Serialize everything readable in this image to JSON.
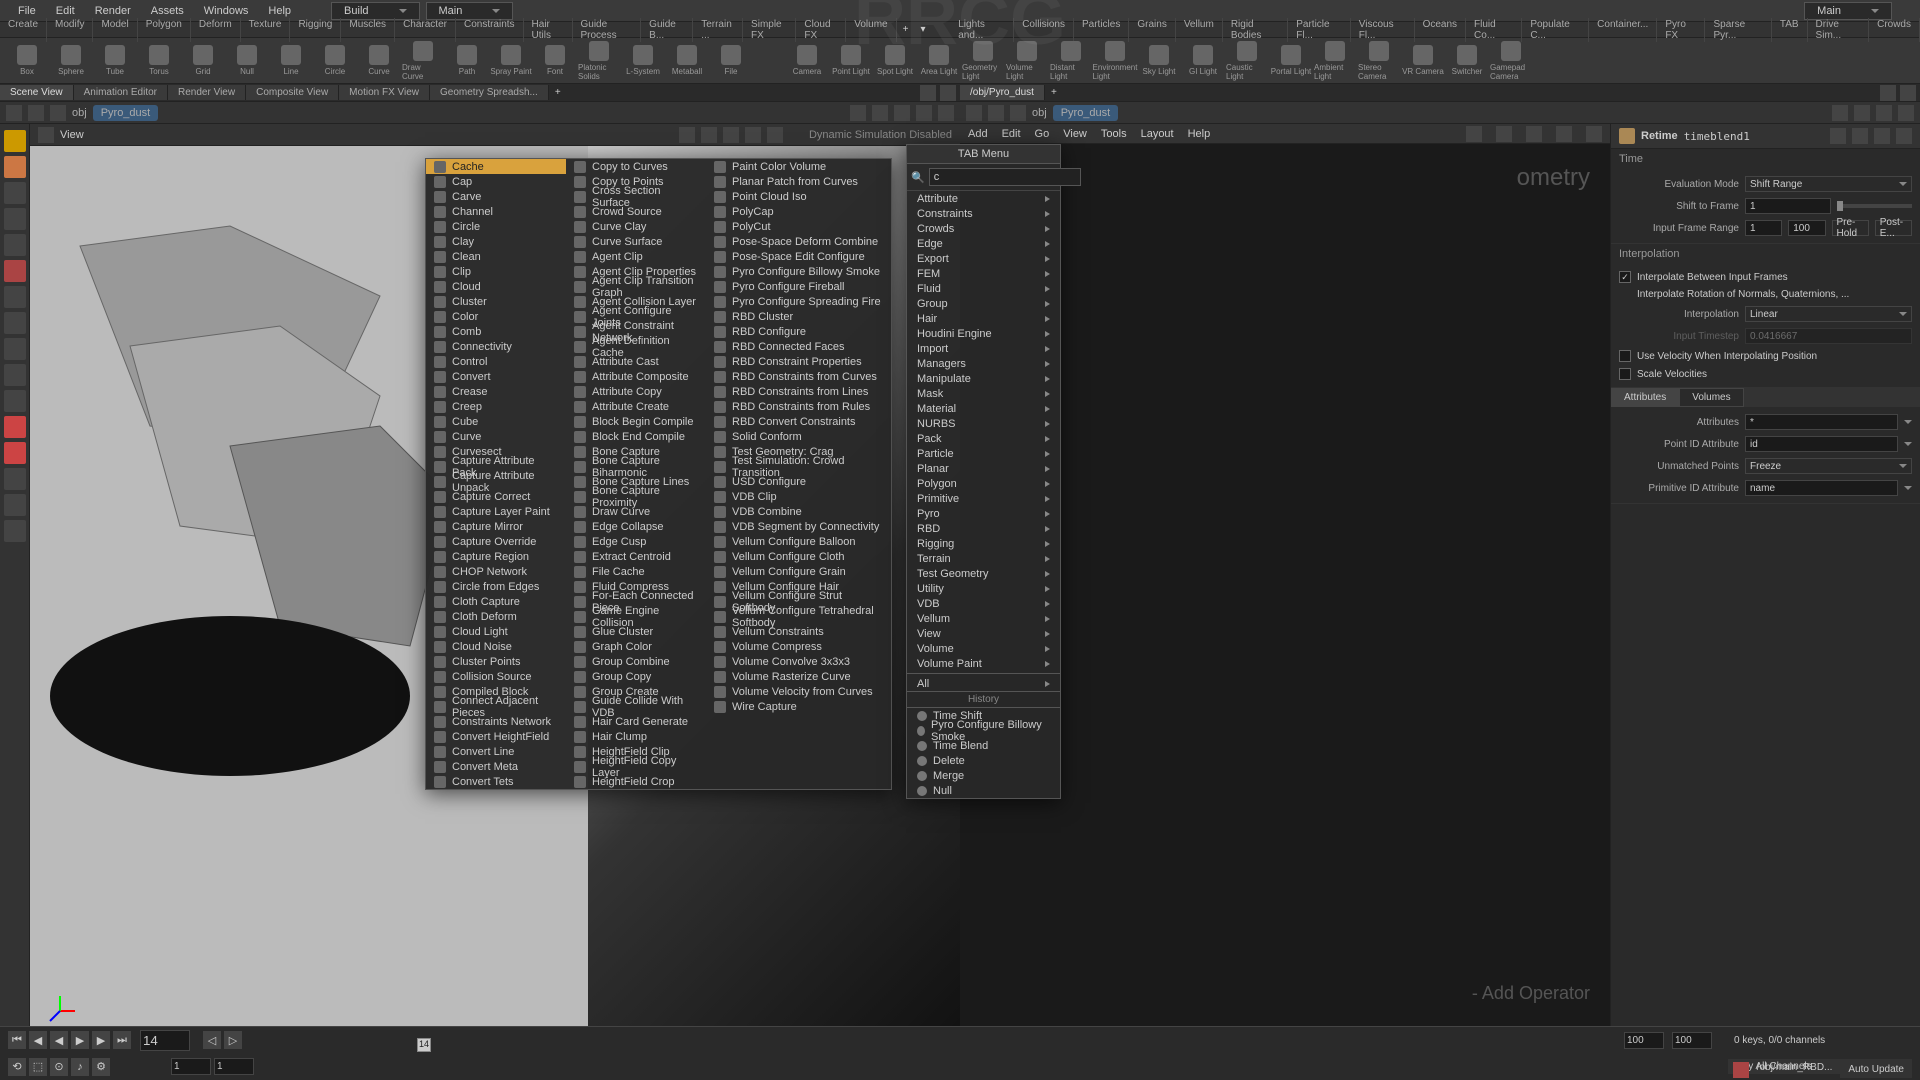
{
  "watermark": "RRCG",
  "menubar": {
    "items": [
      "File",
      "Edit",
      "Render",
      "Assets",
      "Windows",
      "Help"
    ],
    "desktop1": "Build",
    "desktop2": "Main",
    "desktop3": "Main"
  },
  "shelf_tabs_left": [
    "Create",
    "Modify",
    "Model",
    "Polygon",
    "Deform",
    "Texture",
    "Rigging",
    "Muscles",
    "Character",
    "Constraints",
    "Hair Utils",
    "Guide Process",
    "Guide B...",
    "Terrain ...",
    "Simple FX",
    "Cloud FX",
    "Volume"
  ],
  "shelf_tabs_right": [
    "Lights and...",
    "Collisions",
    "Particles",
    "Grains",
    "Vellum",
    "Rigid Bodies",
    "Particle Fl...",
    "Viscous Fl...",
    "Oceans",
    "Fluid Co...",
    "Populate C...",
    "Container...",
    "Pyro FX",
    "Sparse Pyr...",
    "TAB",
    "Drive Sim...",
    "Crowds"
  ],
  "shelf_icons_left": [
    "Box",
    "Sphere",
    "Tube",
    "Torus",
    "Grid",
    "Null",
    "Line",
    "Circle",
    "Curve",
    "Draw Curve",
    "Path",
    "Spray Paint",
    "Font",
    "Platonic Solids",
    "L-System",
    "Metaball",
    "File"
  ],
  "shelf_icons_right": [
    "Camera",
    "Point Light",
    "Spot Light",
    "Area Light",
    "Geometry Light",
    "Volume Light",
    "Distant Light",
    "Environment Light",
    "Sky Light",
    "GI Light",
    "Caustic Light",
    "Portal Light",
    "Ambient Light",
    "Stereo Camera",
    "VR Camera",
    "Switcher",
    "Gamepad Camera"
  ],
  "pane_tabs_left": [
    "Scene View",
    "Animation Editor",
    "Render View",
    "Composite View",
    "Motion FX View",
    "Geometry Spreadsh..."
  ],
  "pane_tabs_right": [
    "/obj/Pyro_dust"
  ],
  "path_left": {
    "obj": "obj",
    "node": "Pyro_dust"
  },
  "path_right": {
    "obj": "obj",
    "node": "Pyro_dust"
  },
  "viewport_label": "View",
  "sim_label": "Dynamic Simulation Disabled",
  "network_menu": [
    "Add",
    "Edit",
    "Go",
    "View",
    "Tools",
    "Layout",
    "Help"
  ],
  "network_texts": {
    "geo": "ometry",
    "addop": "- Add Operator"
  },
  "tab_menu": {
    "title": "TAB Menu",
    "search": "c",
    "col1": [
      "Cache",
      "Cap",
      "Carve",
      "Channel",
      "Circle",
      "Clay",
      "Clean",
      "Clip",
      "Cloud",
      "Cluster",
      "Color",
      "Comb",
      "Connectivity",
      "Control",
      "Convert",
      "Crease",
      "Creep",
      "Cube",
      "Curve",
      "Curvesect",
      "Capture Attribute Pack",
      "Capture Attribute Unpack",
      "Capture Correct",
      "Capture Layer Paint",
      "Capture Mirror",
      "Capture Override",
      "Capture Region",
      "CHOP Network",
      "Circle from Edges",
      "Cloth Capture",
      "Cloth Deform",
      "Cloud Light",
      "Cloud Noise",
      "Cluster Points",
      "Collision Source",
      "Compiled Block",
      "Connect Adjacent Pieces",
      "Constraints Network",
      "Convert HeightField",
      "Convert Line",
      "Convert Meta",
      "Convert Tets"
    ],
    "col2": [
      "Copy to Curves",
      "Copy to Points",
      "Cross Section Surface",
      "Crowd Source",
      "Curve Clay",
      "Curve Surface",
      "Agent Clip",
      "Agent Clip Properties",
      "Agent Clip Transition Graph",
      "Agent Collision Layer",
      "Agent Configure Joints",
      "Agent Constraint Network",
      "Agent Definition Cache",
      "Attribute Cast",
      "Attribute Composite",
      "Attribute Copy",
      "Attribute Create",
      "Block Begin Compile",
      "Block End Compile",
      "Bone Capture",
      "Bone Capture Biharmonic",
      "Bone Capture Lines",
      "Bone Capture Proximity",
      "Draw Curve",
      "Edge Collapse",
      "Edge Cusp",
      "Extract Centroid",
      "File Cache",
      "Fluid Compress",
      "For-Each Connected Piece",
      "Game Engine Collision",
      "Glue Cluster",
      "Graph Color",
      "Group Combine",
      "Group Copy",
      "Group Create",
      "Guide Collide With VDB",
      "Hair Card Generate",
      "Hair Clump",
      "HeightField Clip",
      "HeightField Copy Layer",
      "HeightField Crop"
    ],
    "col3": [
      "Paint Color Volume",
      "Planar Patch from Curves",
      "Point Cloud Iso",
      "PolyCap",
      "PolyCut",
      "Pose-Space Deform Combine",
      "Pose-Space Edit Configure",
      "Pyro Configure Billowy Smoke",
      "Pyro Configure Fireball",
      "Pyro Configure Spreading Fire",
      "RBD Cluster",
      "RBD Configure",
      "RBD Connected Faces",
      "RBD Constraint Properties",
      "RBD Constraints from Curves",
      "RBD Constraints from Lines",
      "RBD Constraints from Rules",
      "RBD Convert Constraints",
      "Solid Conform",
      "Test Geometry: Crag",
      "Test Simulation: Crowd Transition",
      "USD Configure",
      "VDB Clip",
      "VDB Combine",
      "VDB Segment by Connectivity",
      "Vellum Configure Balloon",
      "Vellum Configure Cloth",
      "Vellum Configure Grain",
      "Vellum Configure Hair",
      "Vellum Configure Strut Softbody",
      "Vellum Configure Tetrahedral Softbody",
      "Vellum Constraints",
      "Volume Compress",
      "Volume Convolve 3x3x3",
      "Volume Rasterize Curve",
      "Volume Velocity from Curves",
      "Wire Capture"
    ]
  },
  "categories": [
    "Attribute",
    "Constraints",
    "Crowds",
    "Edge",
    "Export",
    "FEM",
    "Fluid",
    "Group",
    "Hair",
    "Houdini Engine",
    "Import",
    "Managers",
    "Manipulate",
    "Mask",
    "Material",
    "NURBS",
    "Pack",
    "Particle",
    "Planar",
    "Polygon",
    "Primitive",
    "Pyro",
    "RBD",
    "Rigging",
    "Terrain",
    "Test Geometry",
    "Utility",
    "VDB",
    "Vellum",
    "View",
    "Volume",
    "Volume Paint"
  ],
  "cat_all": "All",
  "cat_history_label": "History",
  "cat_history": [
    "Time Shift",
    "Pyro Configure Billowy Smoke",
    "Time Blend",
    "Delete",
    "Merge",
    "Null"
  ],
  "params": {
    "retime": "Retime",
    "node": "timeblend1",
    "time_section": "Time",
    "eval_mode_label": "Evaluation Mode",
    "eval_mode": "Shift Range",
    "shift_frame_label": "Shift to Frame",
    "shift_frame": "1",
    "input_range_label": "Input Frame Range",
    "input_range_start": "1",
    "input_range_end": "100",
    "pre_hold": "Pre-Hold",
    "post_e": "Post-E...",
    "interp_section": "Interpolation",
    "interp_between": "Interpolate Between Input Frames",
    "interp_rot": "Interpolate Rotation of Normals, Quaternions, ...",
    "interp_label": "Interpolation",
    "interp_mode": "Linear",
    "input_ts_label": "Input Timestep",
    "input_ts": "0.0416667",
    "use_vel": "Use Velocity When Interpolating Position",
    "scale_vel": "Scale Velocities",
    "tabs": {
      "attrs": "Attributes",
      "vols": "Volumes"
    },
    "attrs_label": "Attributes",
    "attrs_val": "*",
    "pid_label": "Point ID Attribute",
    "pid_val": "id",
    "unmatch_label": "Unmatched Points",
    "unmatch_val": "Freeze",
    "prim_id_label": "Primitive ID Attribute",
    "prim_id_val": "name"
  },
  "timeline": {
    "frame": "14",
    "start": "1",
    "start2": "1",
    "end": "100",
    "end2": "100",
    "keys": "0 keys, 0/0 channels",
    "key_all": "Key All Channels",
    "path": "/obj/main_RBD...",
    "auto": "Auto Update"
  }
}
